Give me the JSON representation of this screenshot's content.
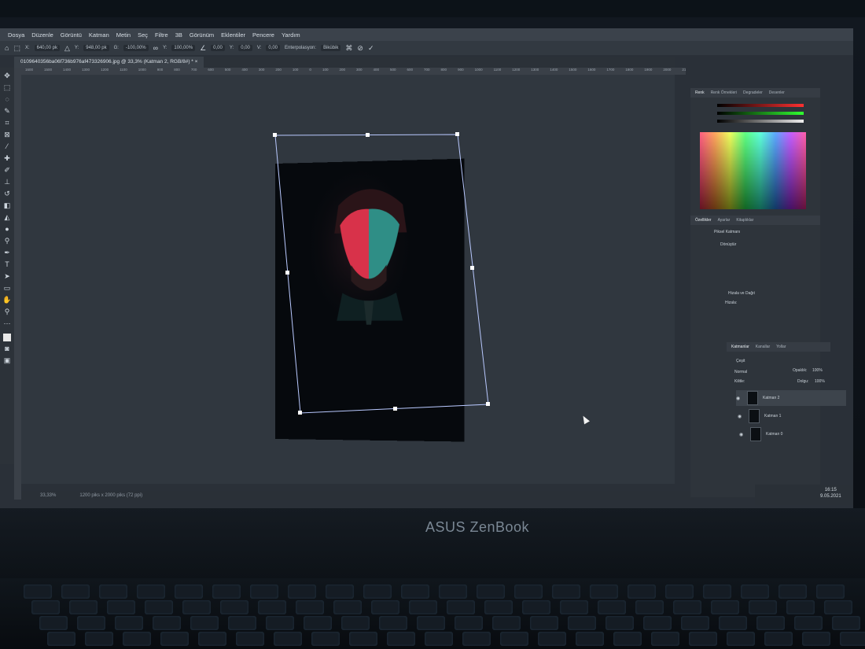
{
  "device": {
    "brand": "ASUS ZenBook"
  },
  "menu": [
    "Dosya",
    "Düzenle",
    "Görüntü",
    "Katman",
    "Metin",
    "Seç",
    "Filtre",
    "3B",
    "Görünüm",
    "Eklentiler",
    "Pencere",
    "Yardım"
  ],
  "options_bar": {
    "x_label": "X:",
    "x_value": "640,00 pk",
    "y_label": "Y:",
    "y_value": "948,00 pk",
    "w_label": "G:",
    "w_value": "-100,00%",
    "h_label": "Y:",
    "h_value": "100,00%",
    "angle_value": "0,00",
    "hskew_label": "Y:",
    "hskew_value": "0,00",
    "vskew_label": "V:",
    "vskew_value": "0,00",
    "interp_label": "Enterpolasyon:",
    "interp_value": "Bikübik"
  },
  "document_tab": "0109640356ba06f736b976af473326906.jpg @ 33,3% (Katman 2, RGB/8#) *",
  "ruler_ticks": [
    "1600",
    "1500",
    "1400",
    "1300",
    "1200",
    "1100",
    "1000",
    "900",
    "800",
    "700",
    "600",
    "500",
    "400",
    "300",
    "200",
    "100",
    "0",
    "100",
    "200",
    "300",
    "400",
    "500",
    "600",
    "700",
    "800",
    "900",
    "1000",
    "1100",
    "1200",
    "1300",
    "1400",
    "1500",
    "1600",
    "1700",
    "1800",
    "1900",
    "2000",
    "2100",
    "2200",
    "2300",
    "2400",
    "2500",
    "2600",
    "2700"
  ],
  "status": {
    "zoom": "33,33%",
    "doc_size": "1200 piks x 2000 piks (72 ppi)"
  },
  "color_panel": {
    "tabs": [
      "Renk",
      "Renk Örnekleri",
      "Degradeler",
      "Desenler"
    ]
  },
  "properties_panel": {
    "tabs": [
      "Özellikler",
      "Ayarlar",
      "Kitaplıklar"
    ],
    "layer_kind": "Piksel Katmanı",
    "transform_title": "Dönüştür",
    "align_title": "Hizala ve Dağıt",
    "align_sub": "Hizala:"
  },
  "layers_panel": {
    "tabs": [
      "Katmanlar",
      "Kanallar",
      "Yollar"
    ],
    "search": "Çeşit",
    "blend_mode": "Normal",
    "opacity_label": "Opaklık:",
    "opacity_value": "100%",
    "lock_label": "Kilitle:",
    "fill_label": "Dolgu:",
    "fill_value": "100%",
    "layers": [
      {
        "name": "Katman 2"
      },
      {
        "name": "Katman 1"
      },
      {
        "name": "Katman 0"
      }
    ]
  },
  "taskbar": {
    "time": "16:15",
    "date": "9.05.2021"
  }
}
